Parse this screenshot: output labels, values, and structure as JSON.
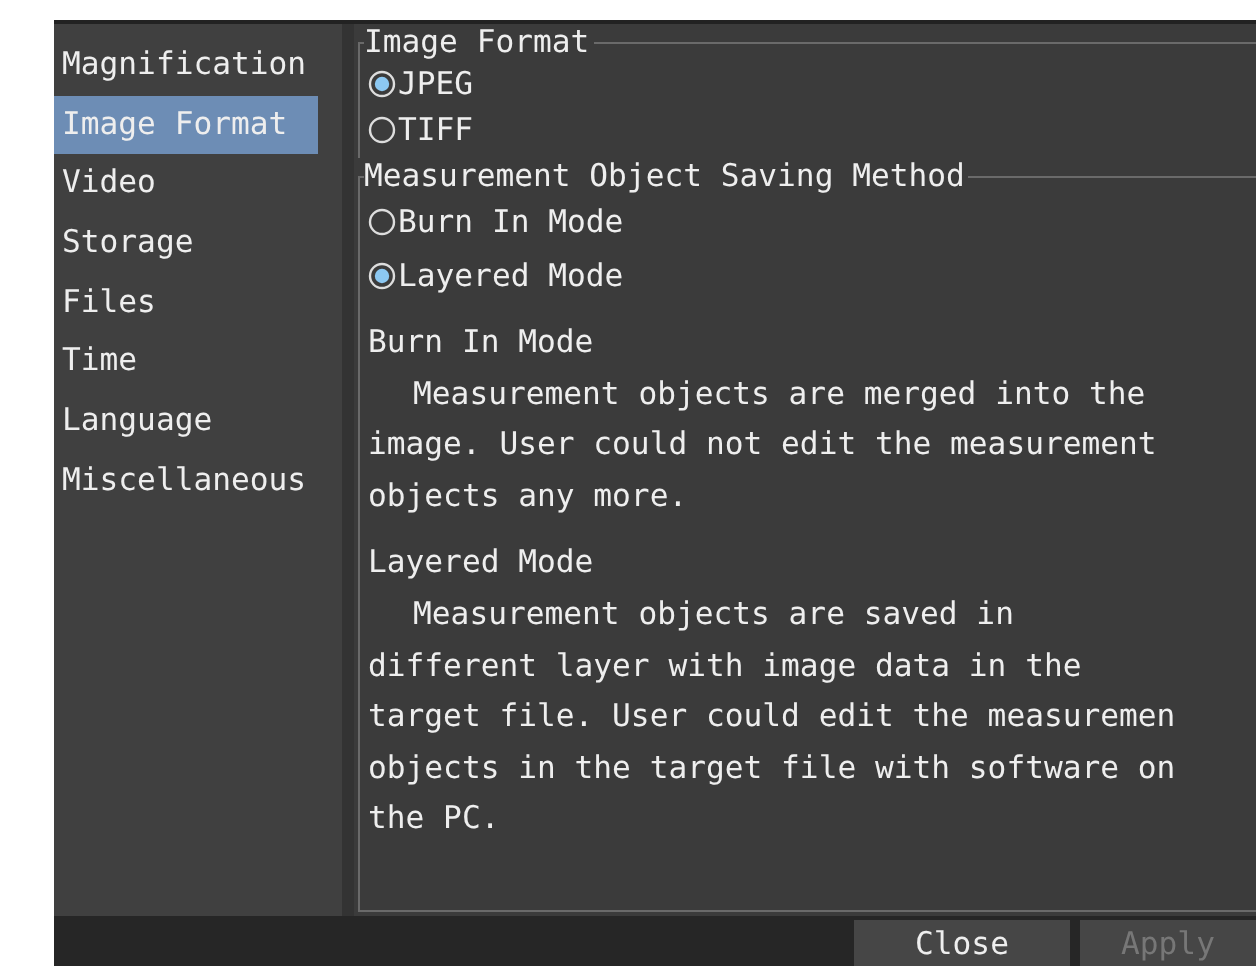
{
  "sidebar": {
    "items": [
      {
        "label": "Magnification",
        "selected": false
      },
      {
        "label": "Image Format",
        "selected": true
      },
      {
        "label": "Video",
        "selected": false
      },
      {
        "label": "Storage",
        "selected": false
      },
      {
        "label": "Files",
        "selected": false
      },
      {
        "label": "Time",
        "selected": false
      },
      {
        "label": "Language",
        "selected": false
      },
      {
        "label": "Miscellaneous",
        "selected": false
      }
    ]
  },
  "groups": [
    {
      "title": "Image Format",
      "options": [
        {
          "label": "JPEG",
          "selected": true
        },
        {
          "label": "TIFF",
          "selected": false
        }
      ]
    },
    {
      "title": "Measurement Object Saving Method",
      "options": [
        {
          "label": "Burn In Mode",
          "selected": false
        },
        {
          "label": "Layered Mode",
          "selected": true
        }
      ],
      "notes": [
        {
          "heading": "Burn In Mode",
          "text": "Measurement objects are merged into the\nimage. User could not edit the measurement\nobjects any more."
        },
        {
          "heading": "Layered Mode",
          "text": "Measurement objects are saved in\ndifferent layer with image data in the\ntarget file. User could edit the measuremen\nobjects in the target file with software on\nthe PC."
        }
      ]
    }
  ],
  "buttons": [
    {
      "label": "Close",
      "disabled": false
    },
    {
      "label": "Apply",
      "disabled": true
    }
  ]
}
